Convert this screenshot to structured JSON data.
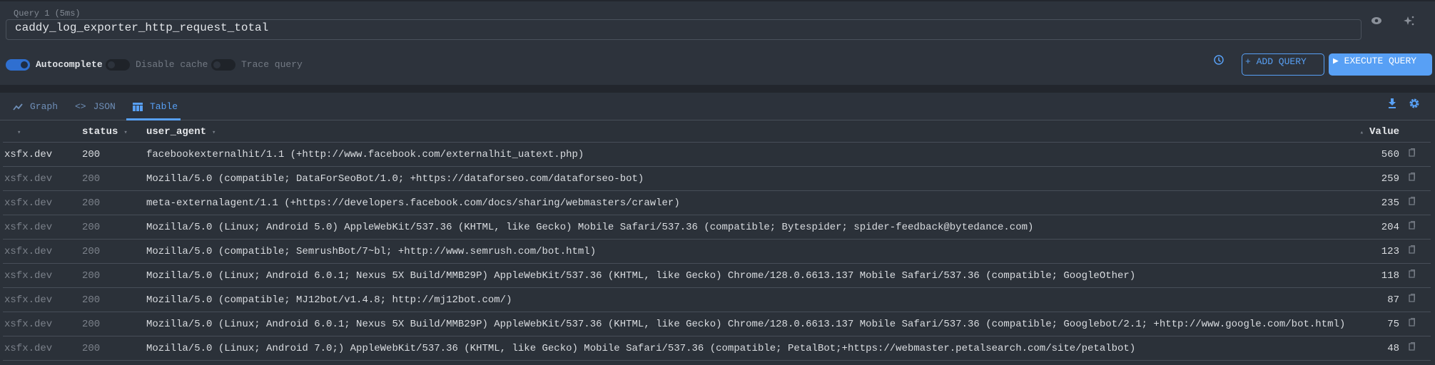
{
  "query": {
    "label": "Query 1 (5ms)",
    "value": "caddy_log_exporter_http_request_total"
  },
  "toggles": [
    {
      "label": "Autocomplete",
      "on": true
    },
    {
      "label": "Disable cache",
      "on": false
    },
    {
      "label": "Trace query",
      "on": false
    }
  ],
  "buttons": {
    "add_query": "+ ADD QUERY",
    "execute_query": "EXECUTE QUERY"
  },
  "tabs": [
    {
      "label": "Graph",
      "icon": "line-chart-icon"
    },
    {
      "label": "JSON",
      "icon": "code-icon"
    },
    {
      "label": "Table",
      "icon": "table-icon",
      "active": true
    }
  ],
  "table": {
    "columns": [
      "",
      "status",
      "user_agent",
      "Value"
    ],
    "rows": [
      {
        "host": "xsfx.dev",
        "status": "200",
        "user_agent": "facebookexternalhit/1.1 (+http://www.facebook.com/externalhit_uatext.php)",
        "value": "560"
      },
      {
        "host": "xsfx.dev",
        "status": "200",
        "user_agent": "Mozilla/5.0 (compatible; DataForSeoBot/1.0; +https://dataforseo.com/dataforseo-bot)",
        "value": "259"
      },
      {
        "host": "xsfx.dev",
        "status": "200",
        "user_agent": "meta-externalagent/1.1 (+https://developers.facebook.com/docs/sharing/webmasters/crawler)",
        "value": "235"
      },
      {
        "host": "xsfx.dev",
        "status": "200",
        "user_agent": "Mozilla/5.0 (Linux; Android 5.0) AppleWebKit/537.36 (KHTML, like Gecko) Mobile Safari/537.36 (compatible; Bytespider; spider-feedback@bytedance.com)",
        "value": "204"
      },
      {
        "host": "xsfx.dev",
        "status": "200",
        "user_agent": "Mozilla/5.0 (compatible; SemrushBot/7~bl; +http://www.semrush.com/bot.html)",
        "value": "123"
      },
      {
        "host": "xsfx.dev",
        "status": "200",
        "user_agent": "Mozilla/5.0 (Linux; Android 6.0.1; Nexus 5X Build/MMB29P) AppleWebKit/537.36 (KHTML, like Gecko) Chrome/128.0.6613.137 Mobile Safari/537.36 (compatible; GoogleOther)",
        "value": "118"
      },
      {
        "host": "xsfx.dev",
        "status": "200",
        "user_agent": "Mozilla/5.0 (compatible; MJ12bot/v1.4.8; http://mj12bot.com/)",
        "value": "87"
      },
      {
        "host": "xsfx.dev",
        "status": "200",
        "user_agent": "Mozilla/5.0 (Linux; Android 6.0.1; Nexus 5X Build/MMB29P) AppleWebKit/537.36 (KHTML, like Gecko) Chrome/128.0.6613.137 Mobile Safari/537.36 (compatible; Googlebot/2.1; +http://www.google.com/bot.html)",
        "value": "75"
      },
      {
        "host": "xsfx.dev",
        "status": "200",
        "user_agent": "Mozilla/5.0 (Linux; Android 7.0;) AppleWebKit/537.36 (KHTML, like Gecko) Mobile Safari/537.36 (compatible; PetalBot;+https://webmaster.petalsearch.com/site/petalbot)",
        "value": "48"
      }
    ]
  },
  "colors": {
    "accent": "#58a0f5",
    "background": "#2b3139"
  }
}
